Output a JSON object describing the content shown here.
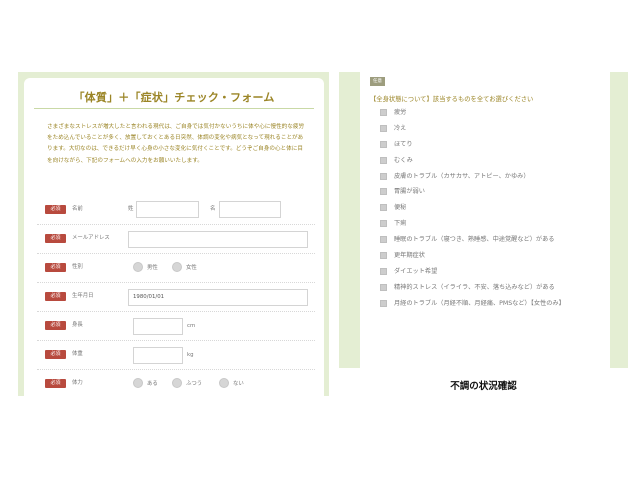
{
  "form": {
    "title": "「体質」＋「症状」チェック・フォーム",
    "intro": "さまざまなストレスが増大したと言われる現代は、ご自身では気付かないうちに体や心に慢性的な疲労をため込んでいることが多く、放置しておくとある日突然、体調の変化や病気となって現れることがあります。大切なのは、できるだけ早く心身の小さな変化に気付くことです。どうぞご自身の心と体に目を向けながら、下記のフォームへの入力をお願いいたします。",
    "required_label": "必須",
    "rows": {
      "name": {
        "label": "名前",
        "sei": "姓",
        "mei": "名",
        "sei_value": "",
        "mei_value": ""
      },
      "email": {
        "label": "メールアドレス",
        "value": ""
      },
      "gender": {
        "label": "性別",
        "options": [
          "男性",
          "女性"
        ]
      },
      "birthdate": {
        "label": "生年月日",
        "value": "1980/01/01"
      },
      "height": {
        "label": "身長",
        "value": "",
        "unit": "cm"
      },
      "weight": {
        "label": "体重",
        "value": "",
        "unit": "kg"
      },
      "stamina": {
        "label": "体力",
        "options": [
          "ある",
          "ふつう",
          "ない"
        ]
      }
    }
  },
  "checklist": {
    "tag": "任意",
    "heading": "【全身状態について】該当するものを全てお選びください",
    "items": [
      "疲労",
      "冷え",
      "ほてり",
      "むくみ",
      "皮膚のトラブル（カサカサ、アトピー、かゆみ）",
      "胃腸が弱い",
      "便秘",
      "下痢",
      "睡眠のトラブル（寝つき、熟睡感、中途覚醒など）がある",
      "更年期症状",
      "ダイエット希望",
      "精神的ストレス（イライラ、不安、落ち込みなど）がある",
      "月経のトラブル（月経不順、月経痛、PMSなど）【女性のみ】"
    ]
  },
  "caption": "不調の状況確認"
}
